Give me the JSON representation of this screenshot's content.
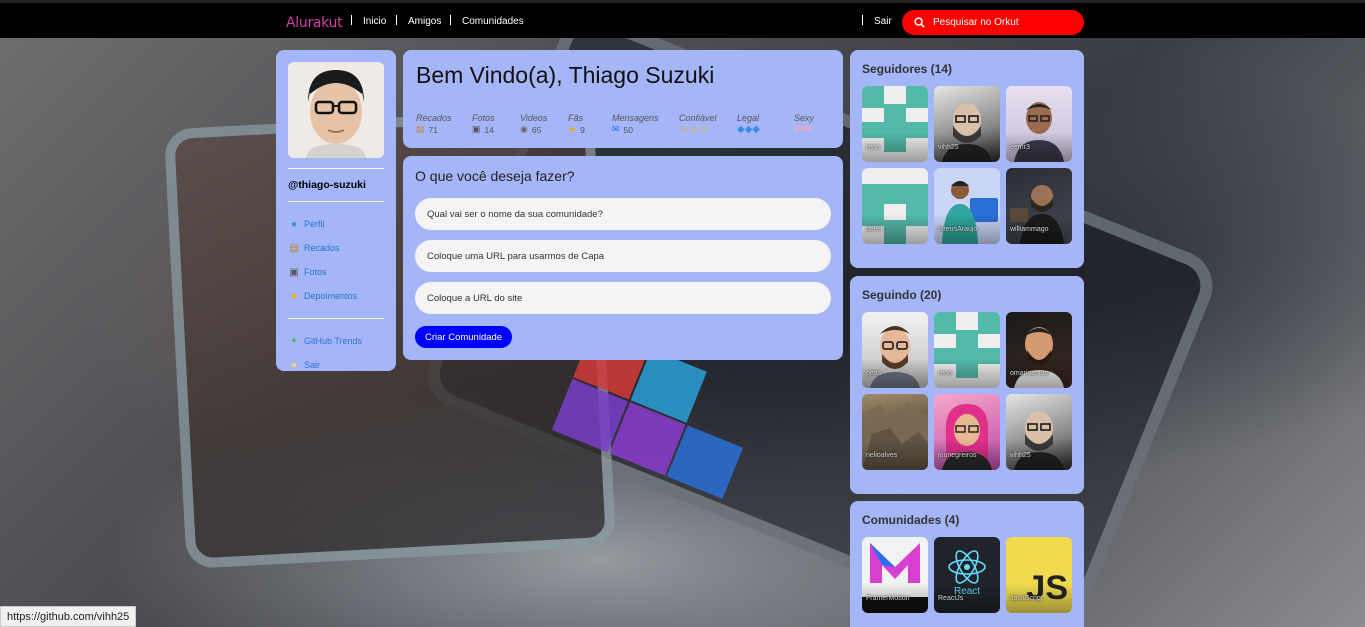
{
  "topbar": {
    "logo": "Alurakut",
    "nav": [
      "Inicio",
      "Amigos",
      "Comunidades"
    ],
    "logout": "Sair",
    "search_placeholder": "Pesquisar no Orkut"
  },
  "profile": {
    "handle": "@thiago-suzuki",
    "menu": [
      {
        "label": "Perfil",
        "icon": "user-icon"
      },
      {
        "label": "Recados",
        "icon": "book-icon"
      },
      {
        "label": "Fotos",
        "icon": "camera-icon"
      },
      {
        "label": "Depoimentos",
        "icon": "sun-icon"
      }
    ],
    "menu2": [
      {
        "label": "GitHub Trends",
        "icon": "plus-icon"
      },
      {
        "label": "Sair",
        "icon": "sun-exit-icon"
      }
    ]
  },
  "welcome": {
    "title": "Bem Vindo(a), Thiago Suzuki",
    "stats": [
      {
        "label": "Recados",
        "value": "71",
        "icon": "book-icon"
      },
      {
        "label": "Fotos",
        "value": "14",
        "icon": "camera-icon"
      },
      {
        "label": "Videos",
        "value": "65",
        "icon": "video-icon"
      },
      {
        "label": "Fãs",
        "value": "9",
        "icon": "star-icon"
      },
      {
        "label": "Mensagens",
        "value": "50",
        "icon": "mail-icon"
      },
      {
        "label": "Confiável",
        "value": "",
        "icon": "smiley-icon"
      },
      {
        "label": "Legal",
        "value": "",
        "icon": "ice-icon"
      },
      {
        "label": "Sexy",
        "value": "",
        "icon": "heart-icon"
      }
    ]
  },
  "form": {
    "title": "O que você deseja fazer?",
    "placeholders": [
      "Qual vai ser o nome da sua comunidade?",
      "Coloque uma URL para usarmos de Capa",
      "Coloque a URL do site"
    ],
    "submit": "Criar Comunidade"
  },
  "followers": {
    "title": "Seguidores (14)",
    "items": [
      "reno",
      "vihh25",
      "eemr3",
      "deleil",
      "tateusAraujo",
      "williammago"
    ]
  },
  "following": {
    "title": "Seguindo (20)",
    "items": [
      "peas",
      "reno",
      "omariosouto",
      "nelioalves",
      "juunegreiros",
      "vihh25"
    ]
  },
  "communities": {
    "title": "Comunidades (4)",
    "items": [
      "FramerMotion",
      "ReactJs",
      "JavaScript"
    ]
  },
  "status_url": "https://github.com/vihh25",
  "colors": {
    "panel": "#a4b6f7",
    "search": "#ff0000",
    "button": "#0000ff",
    "logo": "#d63fa8",
    "link": "#2e6fd0"
  }
}
